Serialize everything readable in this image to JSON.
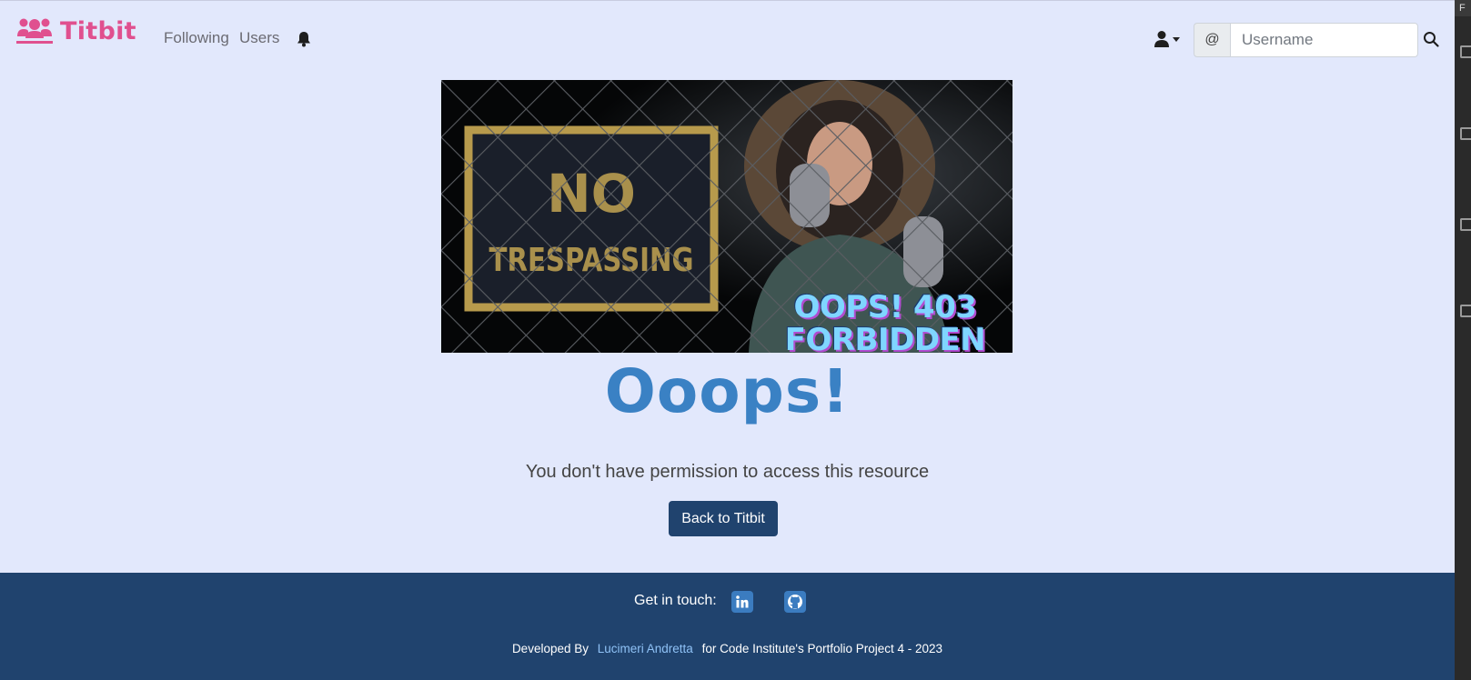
{
  "header": {
    "brand": "Titbit",
    "nav": {
      "following": "Following",
      "users": "Users"
    },
    "search": {
      "addon": "@",
      "placeholder": "Username",
      "value": ""
    }
  },
  "main": {
    "image_caption": "OOPS! 403 FORBIDDEN",
    "heading": "Ooops!",
    "message": "You don't have permission to access this resource",
    "back_button": "Back to Titbit"
  },
  "footer": {
    "get_in_touch": "Get in touch:",
    "developed_by": "Developed By",
    "developer_name": "Lucimeri Andretta",
    "credit_suffix": "for Code Institute's Portfolio Project 4 - 2023"
  },
  "icons": [
    "people-logo-icon",
    "bell-icon",
    "user-icon",
    "search-icon",
    "linkedin-icon",
    "github-icon"
  ],
  "colors": {
    "page_background": "#e2e8fc",
    "brand": "#e0508f",
    "heading": "#3a81c4",
    "button": "#20436e",
    "footer": "#20436e",
    "footer_link": "#8fc2f6"
  }
}
